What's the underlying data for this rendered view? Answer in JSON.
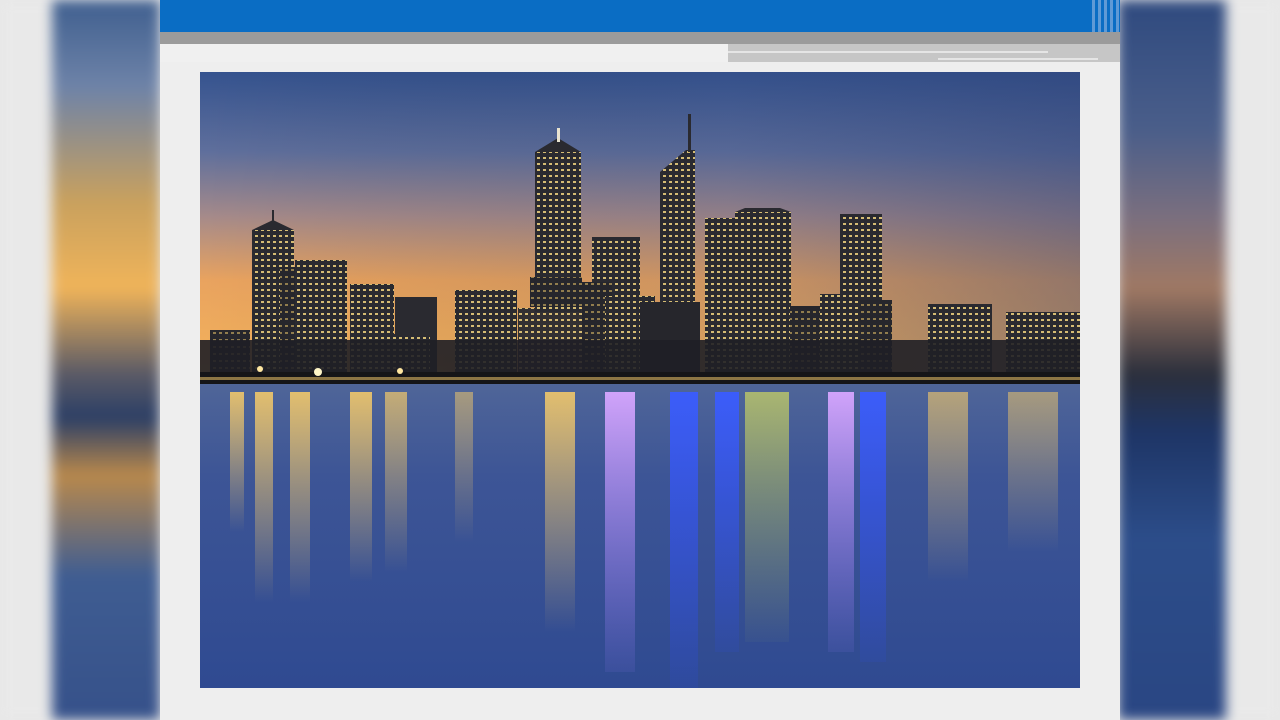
{
  "slide": {
    "accent_color": "#0a6dc4",
    "secondary_bar_color": "#9b9b9b",
    "panel_color": "#eeeeee"
  },
  "photo": {
    "icon": "city-skyline-photo",
    "sky_colors": [
      "#3a5a93",
      "#7f86a0",
      "#e6a35e",
      "#f3b15a"
    ],
    "water_color": "#3b5595"
  }
}
